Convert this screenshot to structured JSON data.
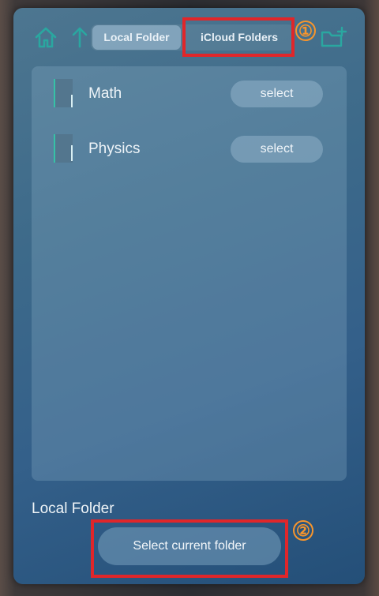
{
  "toolbar": {
    "tabs": [
      {
        "label": "Local Folder",
        "selected": true
      },
      {
        "label": "iCloud Folders",
        "selected": false
      }
    ],
    "icons": [
      "home-icon",
      "up-arrow-icon",
      "new-folder-icon"
    ]
  },
  "folders": [
    {
      "name": "Math",
      "action_label": "select"
    },
    {
      "name": "Physics",
      "action_label": "select"
    }
  ],
  "footer": {
    "current_location": "Local Folder",
    "primary_action": "Select current folder"
  },
  "annotations": {
    "callout_1": "①",
    "callout_2": "②",
    "highlight_color": "#e0262a",
    "callout_color": "#f7952c"
  },
  "colors": {
    "accent": "#2aa7a0"
  }
}
